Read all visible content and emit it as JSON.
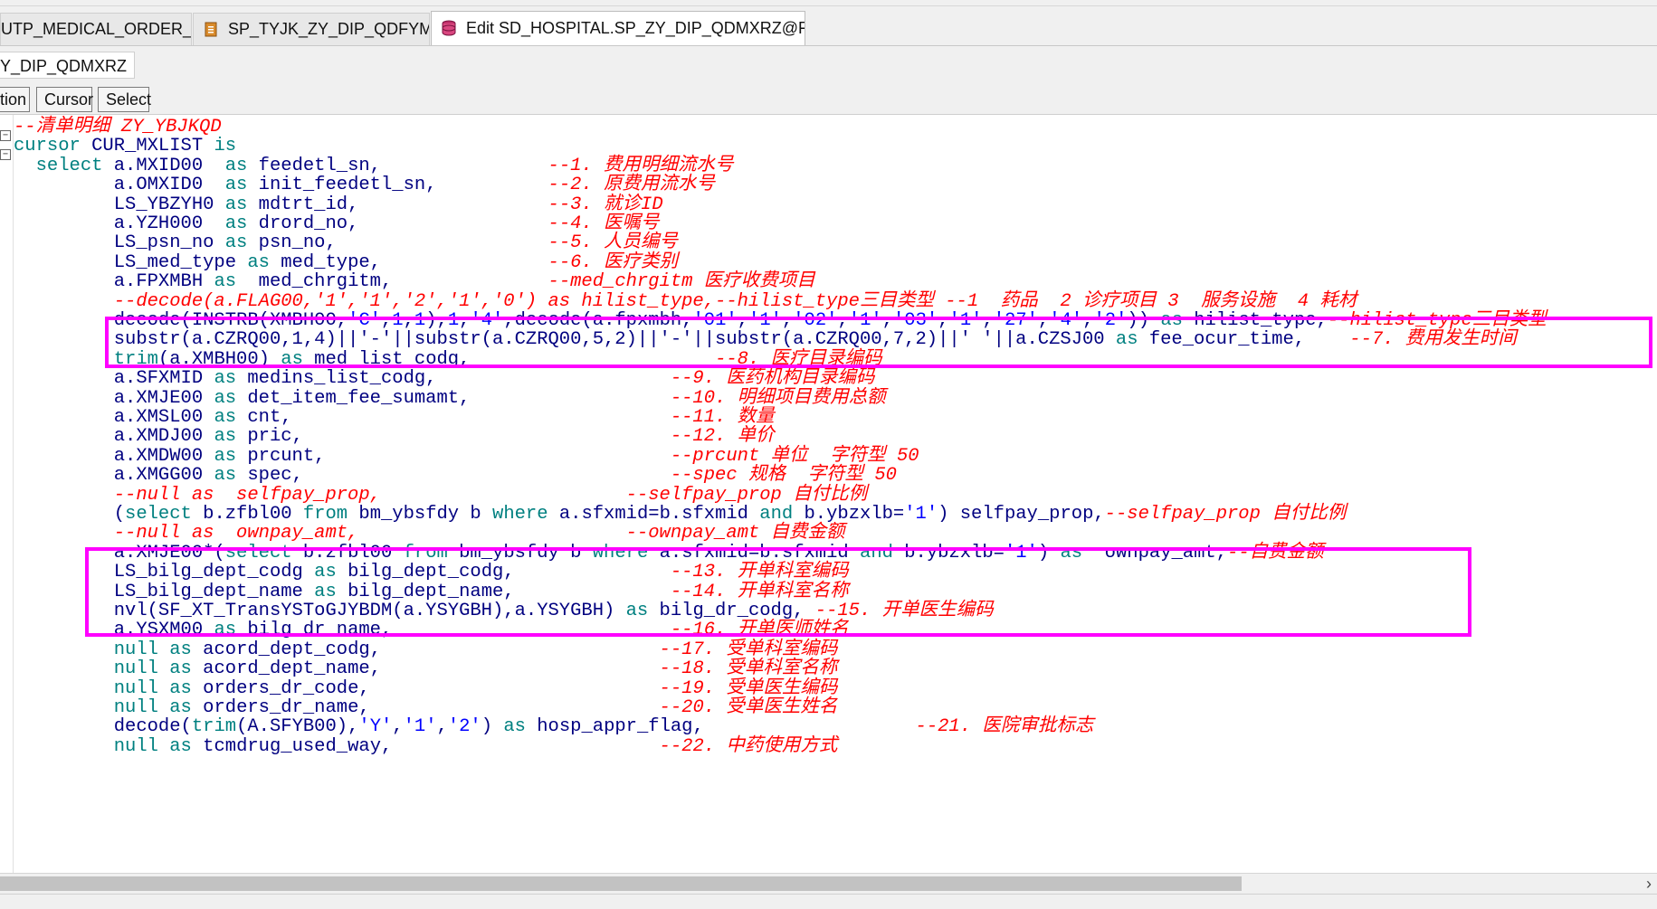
{
  "tabs": [
    {
      "label": "UTP_MEDICAL_ORDER_HTBL ...",
      "icon": "procedure-icon",
      "active": false
    },
    {
      "label": "SP_TYJK_ZY_DIP_QDFYMX; SP_ ...",
      "icon": "database-procedure-icon",
      "active": false
    },
    {
      "label": "Edit SD_HOSPITAL.SP_ZY_DIP_QDMXRZ@FUANZS",
      "icon": "database-edit-icon",
      "active": true
    }
  ],
  "subtab": {
    "label": "Y_DIP_QDMXRZ"
  },
  "buttons": [
    {
      "label": "tion"
    },
    {
      "label": "Cursor"
    },
    {
      "label": "Select"
    }
  ],
  "colors": {
    "highlight_box": "#ff00ff",
    "comment": "#ff0000",
    "keyword": "#008080",
    "string": "#0000ff",
    "identifier": "#000080"
  },
  "code_lines": [
    [
      [
        "cm",
        "--清单明细 ZY_YBJKQD"
      ]
    ],
    [
      [
        "kw",
        "cursor"
      ],
      [
        "code",
        " CUR_MXLIST "
      ],
      [
        "kw",
        "is"
      ]
    ],
    [
      [
        "code",
        "  "
      ],
      [
        "kw",
        "select"
      ],
      [
        "code",
        " a.MXID00  "
      ],
      [
        "kw",
        "as"
      ],
      [
        "code",
        " feedetl_sn,               "
      ],
      [
        "cm",
        "--1. 费用明细流水号"
      ]
    ],
    [
      [
        "code",
        "         a.OMXID0  "
      ],
      [
        "kw",
        "as"
      ],
      [
        "code",
        " init_feedetl_sn,          "
      ],
      [
        "cm",
        "--2. 原费用流水号"
      ]
    ],
    [
      [
        "code",
        "         LS_YBZYH0 "
      ],
      [
        "kw",
        "as"
      ],
      [
        "code",
        " mdtrt_id,                 "
      ],
      [
        "cm",
        "--3. 就诊ID"
      ]
    ],
    [
      [
        "code",
        "         a.YZH000  "
      ],
      [
        "kw",
        "as"
      ],
      [
        "code",
        " drord_no,                 "
      ],
      [
        "cm",
        "--4. 医嘱号"
      ]
    ],
    [
      [
        "code",
        "         LS_psn_no "
      ],
      [
        "kw",
        "as"
      ],
      [
        "code",
        " psn_no,                   "
      ],
      [
        "cm",
        "--5. 人员编号"
      ]
    ],
    [
      [
        "code",
        "         LS_med_type "
      ],
      [
        "kw",
        "as"
      ],
      [
        "code",
        " med_type,               "
      ],
      [
        "cm",
        "--6. 医疗类别"
      ]
    ],
    [
      [
        "code",
        "         a.FPXMBH "
      ],
      [
        "kw",
        "as"
      ],
      [
        "code",
        "  med_chrgitm,              "
      ],
      [
        "cm",
        "--med_chrgitm 医疗收费项目"
      ]
    ],
    [
      [
        "code",
        "         "
      ],
      [
        "cm",
        "--decode(a.FLAG00,'1','1','2','1','0') as hilist_type,--hilist_type三目类型 --1  药品  2 诊疗项目 3  服务设施  4 耗材"
      ]
    ],
    [
      [
        "code",
        "         decode(INSTRB(XMBH00,"
      ],
      [
        "str",
        "'C'"
      ],
      [
        "code",
        ","
      ],
      [
        "num",
        "1"
      ],
      [
        "code",
        ","
      ],
      [
        "num",
        "1"
      ],
      [
        "code",
        "),"
      ],
      [
        "num",
        "1"
      ],
      [
        "code",
        ","
      ],
      [
        "str",
        "'4'"
      ],
      [
        "code",
        ",decode(a.fpxmbh,"
      ],
      [
        "str",
        "'01'"
      ],
      [
        "code",
        ","
      ],
      [
        "str",
        "'1'"
      ],
      [
        "code",
        ","
      ],
      [
        "str",
        "'02'"
      ],
      [
        "code",
        ","
      ],
      [
        "str",
        "'1'"
      ],
      [
        "code",
        ","
      ],
      [
        "str",
        "'03'"
      ],
      [
        "code",
        ","
      ],
      [
        "str",
        "'1'"
      ],
      [
        "code",
        ","
      ],
      [
        "str",
        "'27'"
      ],
      [
        "code",
        ","
      ],
      [
        "str",
        "'4'"
      ],
      [
        "code",
        ","
      ],
      [
        "str",
        "'2'"
      ],
      [
        "code",
        ")) "
      ],
      [
        "kw",
        "as"
      ],
      [
        "code",
        " hilist_type,"
      ],
      [
        "cm",
        "--hilist_type三目类型"
      ]
    ],
    [
      [
        "code",
        "         substr(a.CZRQ00,1,4)||'-'||substr(a.CZRQ00,5,2)||'-'||substr(a.CZRQ00,7,2)||' '||a.CZSJ00 "
      ],
      [
        "kw",
        "as"
      ],
      [
        "code",
        " fee_ocur_time,    "
      ],
      [
        "cm",
        "--7. 费用发生时间"
      ]
    ],
    [
      [
        "code",
        "         "
      ],
      [
        "kw",
        "trim"
      ],
      [
        "code",
        "(a.XMBH00) "
      ],
      [
        "kw",
        "as"
      ],
      [
        "code",
        " med_list_codg,                      "
      ],
      [
        "cm",
        "--8. 医疗目录编码"
      ]
    ],
    [
      [
        "code",
        "         a.SFXMID "
      ],
      [
        "kw",
        "as"
      ],
      [
        "code",
        " medins_list_codg,                     "
      ],
      [
        "cm",
        "--9. 医药机构目录编码"
      ]
    ],
    [
      [
        "code",
        "         a.XMJE00 "
      ],
      [
        "kw",
        "as"
      ],
      [
        "code",
        " det_item_fee_sumamt,                  "
      ],
      [
        "cm",
        "--10. 明细项目费用总额"
      ]
    ],
    [
      [
        "code",
        "         a.XMSL00 "
      ],
      [
        "kw",
        "as"
      ],
      [
        "code",
        " cnt,                                  "
      ],
      [
        "cm",
        "--11. 数量"
      ]
    ],
    [
      [
        "code",
        "         a.XMDJ00 "
      ],
      [
        "kw",
        "as"
      ],
      [
        "code",
        " pric,                                 "
      ],
      [
        "cm",
        "--12. 单价"
      ]
    ],
    [
      [
        "code",
        "         a.XMDW00 "
      ],
      [
        "kw",
        "as"
      ],
      [
        "code",
        " prcunt,                               "
      ],
      [
        "cm",
        "--prcunt 单位  字符型 50"
      ]
    ],
    [
      [
        "code",
        "         a.XMGG00 "
      ],
      [
        "kw",
        "as"
      ],
      [
        "code",
        " spec,                                 "
      ],
      [
        "cm",
        "--spec 规格  字符型 50"
      ]
    ],
    [
      [
        "code",
        "         "
      ],
      [
        "cm",
        "--null as  selfpay_prop,                      --selfpay_prop 自付比例"
      ]
    ],
    [
      [
        "code",
        "         ("
      ],
      [
        "kw",
        "select"
      ],
      [
        "code",
        " b.zfbl00 "
      ],
      [
        "kw",
        "from"
      ],
      [
        "code",
        " bm_ybsfdy b "
      ],
      [
        "kw",
        "where"
      ],
      [
        "code",
        " a.sfxmid=b.sfxmid "
      ],
      [
        "kw",
        "and"
      ],
      [
        "code",
        " b.ybzxlb="
      ],
      [
        "str",
        "'1'"
      ],
      [
        "code",
        ") selfpay_prop,"
      ],
      [
        "cm",
        "--selfpay_prop 自付比例"
      ]
    ],
    [
      [
        "code",
        "         "
      ],
      [
        "cm",
        "--null as  ownpay_amt,                        --ownpay_amt 自费金额"
      ]
    ],
    [
      [
        "code",
        "         a.XMJE00*("
      ],
      [
        "kw",
        "select"
      ],
      [
        "code",
        " b.zfbl00 "
      ],
      [
        "kw",
        "from"
      ],
      [
        "code",
        " bm_ybsfdy b "
      ],
      [
        "kw",
        "where"
      ],
      [
        "code",
        " a.sfxmid=b.sfxmid "
      ],
      [
        "kw",
        "and"
      ],
      [
        "code",
        " b.ybzxlb="
      ],
      [
        "str",
        "'1'"
      ],
      [
        "code",
        ") "
      ],
      [
        "kw",
        "as"
      ],
      [
        "code",
        "  ownpay_amt,"
      ],
      [
        "cm",
        "--自费金额"
      ]
    ],
    [
      [
        "code",
        "         LS_bilg_dept_codg "
      ],
      [
        "kw",
        "as"
      ],
      [
        "code",
        " bilg_dept_codg,              "
      ],
      [
        "cm",
        "--13. 开单科室编码"
      ]
    ],
    [
      [
        "code",
        "         LS_bilg_dept_name "
      ],
      [
        "kw",
        "as"
      ],
      [
        "code",
        " bilg_dept_name,              "
      ],
      [
        "cm",
        "--14. 开单科室名称"
      ]
    ],
    [
      [
        "code",
        "         nvl(SF_XT_TransYSToGJYBDM(a.YSYGBH),a.YSYGBH) "
      ],
      [
        "kw",
        "as"
      ],
      [
        "code",
        " bilg_dr_codg, "
      ],
      [
        "cm",
        "--15. 开单医生编码"
      ]
    ],
    [
      [
        "code",
        "         a.YSXM00 "
      ],
      [
        "kw",
        "as"
      ],
      [
        "code",
        " bilg_dr_name,                         "
      ],
      [
        "cm",
        "--16. 开单医师姓名"
      ]
    ],
    [
      [
        "code",
        "         "
      ],
      [
        "kw",
        "null"
      ],
      [
        "code",
        " "
      ],
      [
        "kw",
        "as"
      ],
      [
        "code",
        " acord_dept_codg,                         "
      ],
      [
        "cm",
        "--17. 受单科室编码"
      ]
    ],
    [
      [
        "code",
        "         "
      ],
      [
        "kw",
        "null"
      ],
      [
        "code",
        " "
      ],
      [
        "kw",
        "as"
      ],
      [
        "code",
        " acord_dept_name,                         "
      ],
      [
        "cm",
        "--18. 受单科室名称"
      ]
    ],
    [
      [
        "code",
        "         "
      ],
      [
        "kw",
        "null"
      ],
      [
        "code",
        " "
      ],
      [
        "kw",
        "as"
      ],
      [
        "code",
        " orders_dr_code,                          "
      ],
      [
        "cm",
        "--19. 受单医生编码"
      ]
    ],
    [
      [
        "code",
        "         "
      ],
      [
        "kw",
        "null"
      ],
      [
        "code",
        " "
      ],
      [
        "kw",
        "as"
      ],
      [
        "code",
        " orders_dr_name,                          "
      ],
      [
        "cm",
        "--20. 受单医生姓名"
      ]
    ],
    [
      [
        "code",
        "         decode("
      ],
      [
        "kw",
        "trim"
      ],
      [
        "code",
        "(A.SFYB00),"
      ],
      [
        "str",
        "'Y'"
      ],
      [
        "code",
        ","
      ],
      [
        "str",
        "'1'"
      ],
      [
        "code",
        ","
      ],
      [
        "str",
        "'2'"
      ],
      [
        "code",
        ") "
      ],
      [
        "kw",
        "as"
      ],
      [
        "code",
        " hosp_appr_flag,                   "
      ],
      [
        "cm",
        "--21. 医院审批标志"
      ]
    ],
    [
      [
        "code",
        "         "
      ],
      [
        "kw",
        "null"
      ],
      [
        "code",
        " "
      ],
      [
        "kw",
        "as"
      ],
      [
        "code",
        " tcmdrug_used_way,                        "
      ],
      [
        "cm",
        "--22. 中药使用方式"
      ]
    ]
  ]
}
